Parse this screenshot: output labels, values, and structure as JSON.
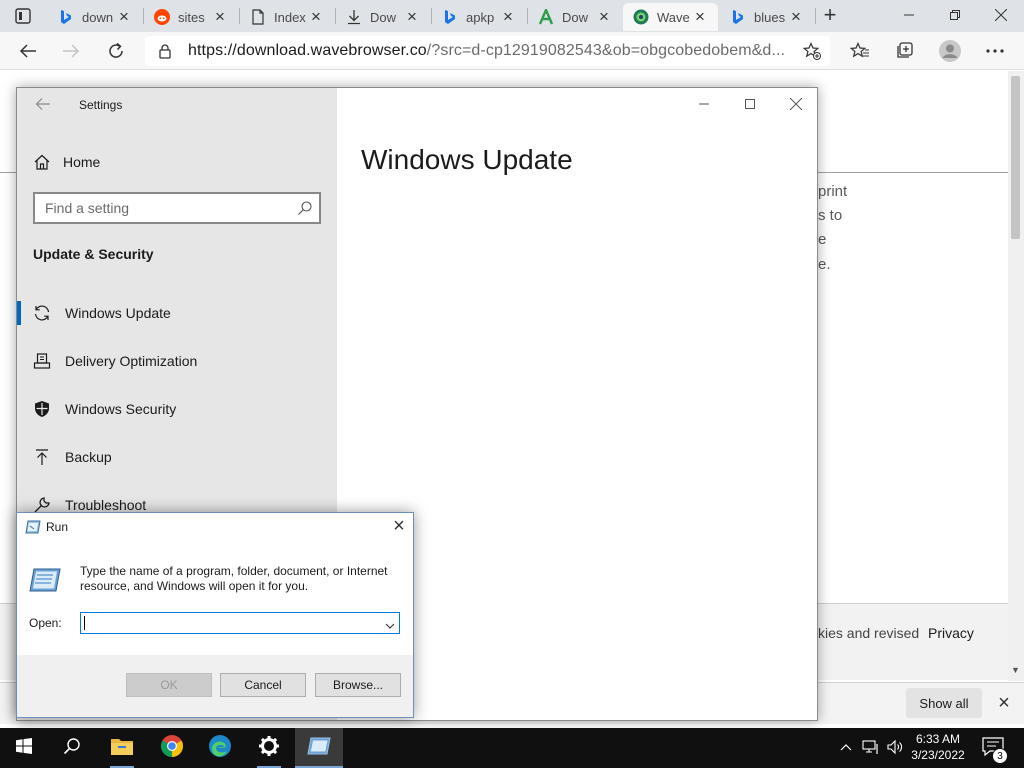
{
  "browser": {
    "tabs": [
      {
        "title": "down",
        "icon": "bing-icon"
      },
      {
        "title": "sites",
        "icon": "reddit-icon"
      },
      {
        "title": "Index",
        "icon": "document-icon"
      },
      {
        "title": "Dow",
        "icon": "download-icon"
      },
      {
        "title": "apkp",
        "icon": "bing-icon"
      },
      {
        "title": "Dow",
        "icon": "green-a-icon"
      },
      {
        "title": "Wave",
        "icon": "wavebrowser-icon"
      },
      {
        "title": "blues",
        "icon": "bing-icon"
      }
    ],
    "url_host": "https://download.wavebrowser.co",
    "url_rest": "/?src=d-cp12919082543&ob=obgcobedobem&d..."
  },
  "page": {
    "fragments": [
      "print",
      "s to",
      "e",
      "e."
    ],
    "cookie_text": "kies and revised",
    "privacy_link": "Privacy",
    "show_all": "Show all"
  },
  "settings": {
    "title": "Settings",
    "home": "Home",
    "search_placeholder": "Find a setting",
    "section": "Update & Security",
    "nav": [
      {
        "label": "Windows Update",
        "icon": "refresh-icon",
        "selected": true
      },
      {
        "label": "Delivery Optimization",
        "icon": "delivery-optimization-icon"
      },
      {
        "label": "Windows Security",
        "icon": "shield-icon"
      },
      {
        "label": "Backup",
        "icon": "backup-icon"
      },
      {
        "label": "Troubleshoot",
        "icon": "wrench-icon"
      }
    ],
    "heading": "Windows Update"
  },
  "run": {
    "title": "Run",
    "description": "Type the name of a program, folder, document, or Internet resource, and Windows will open it for you.",
    "open_label": "Open:",
    "open_value": "",
    "ok": "OK",
    "cancel": "Cancel",
    "browse": "Browse..."
  },
  "taskbar": {
    "time": "6:33 AM",
    "date": "3/23/2022",
    "notification_count": "3"
  },
  "colors": {
    "accent": "#0067c0",
    "taskbar": "#101010",
    "settings_nav_bg": "#e6e6e6"
  }
}
